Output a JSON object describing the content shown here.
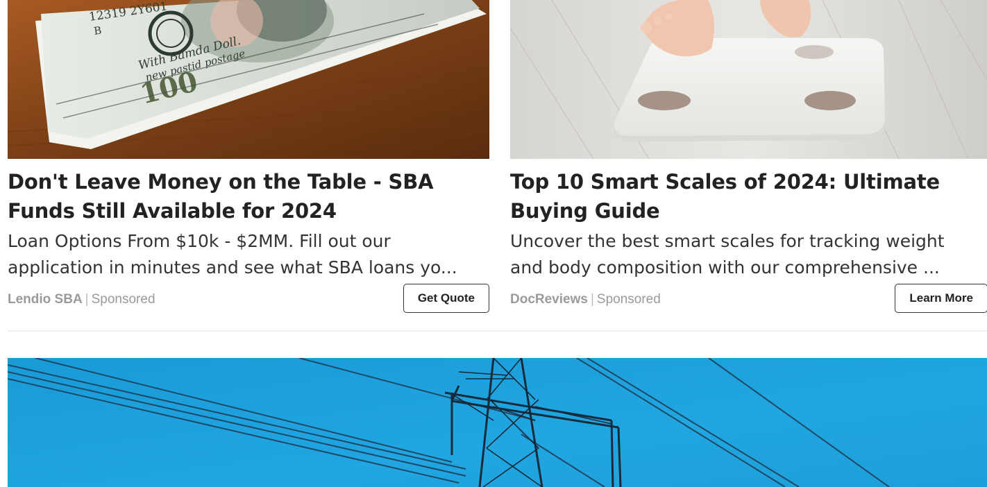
{
  "ads": [
    {
      "headline": "Don't Leave Money on the Table - SBA Funds Still Available for 2024",
      "description_line1": "Loan Options From $10k - $2MM. Fill out our",
      "description_line2": "application in minutes and see what SBA loans yo...",
      "advertiser": "Lendio SBA",
      "separator": "|",
      "label": "Sponsored",
      "cta": "Get Quote",
      "image_text": {
        "serial": "12319 2Y601",
        "letter": "B",
        "handwriting_1": "With Bamda Doll.",
        "handwriting_2": "new pastid postage",
        "denomination": "100"
      }
    },
    {
      "headline": "Top 10 Smart Scales of 2024: Ultimate Buying Guide",
      "description_line1": "Uncover the best smart scales for tracking weight",
      "description_line2": "and body composition with our comprehensive ...",
      "advertiser": "DocReviews",
      "separator": "|",
      "label": "Sponsored",
      "cta": "Learn More"
    }
  ],
  "colors": {
    "headline": "#222222",
    "meta_gray": "#9a9a9a",
    "sky_blue": "#1ca3df",
    "wood": "#7a3f16"
  }
}
